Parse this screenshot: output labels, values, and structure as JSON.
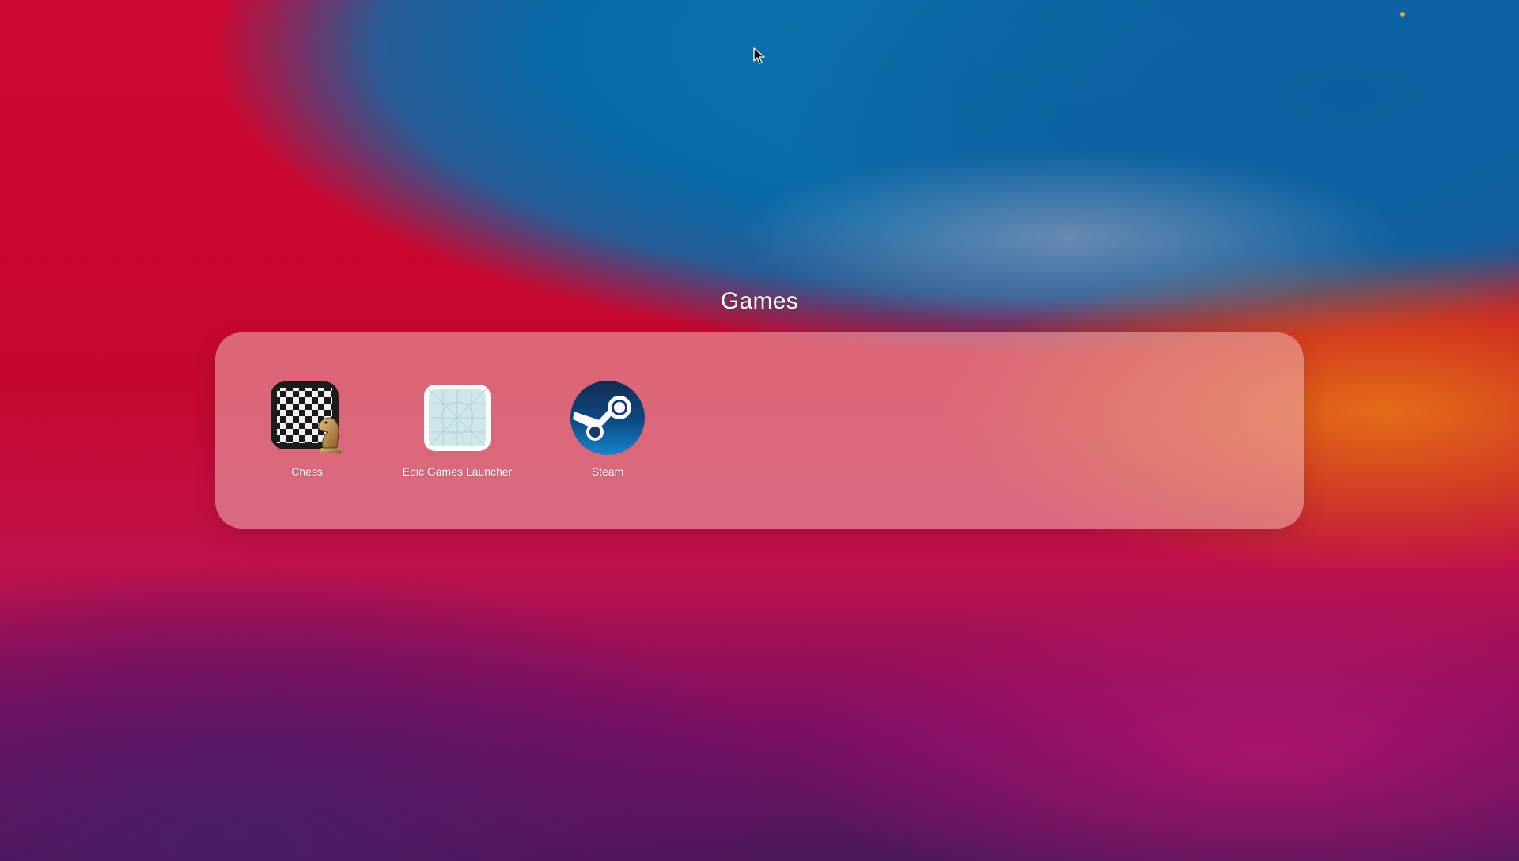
{
  "folder": {
    "title": "Games",
    "apps": [
      {
        "label": "Chess",
        "icon": "chess-icon"
      },
      {
        "label": "Epic Games Launcher",
        "icon": "epic-games-icon"
      },
      {
        "label": "Steam",
        "icon": "steam-icon"
      }
    ]
  },
  "colors": {
    "status_dot": "#e8a13a",
    "label_text": "#ffffff"
  }
}
